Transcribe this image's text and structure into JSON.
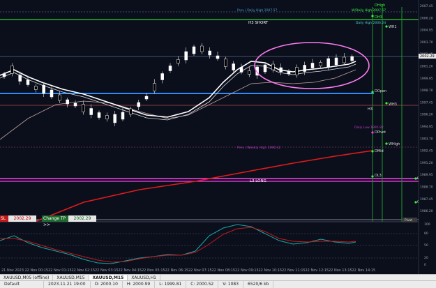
{
  "colors": {
    "background": "#0b0f1c",
    "bull_candle": "#ffffff",
    "bear_candle": "#000000",
    "ema_fast": "#ffffff",
    "ema_slow": "#c0a0a0",
    "red_trend": "#e11b1b",
    "blue_level": "#2a8cff",
    "magenta_level": "#ff3cf0",
    "green_level": "#33ff33",
    "annotation_pink": "#ff7cf0",
    "osc_teal": "#1aa6a6",
    "osc_red": "#c21a1a"
  },
  "level_labels": {
    "dhigh": "DHigh",
    "prev_daily_high": "Prev / Daily High 2007.57",
    "wdaily_high": "W/Daily High 2007.57",
    "dh3": "DH3",
    "daily_high": "Daily High 2006.24",
    "h3_short": "H3 SHORT",
    "wr1": "WR1",
    "dopen": "DOpen",
    "h3": "H3",
    "wh3": "WH3",
    "daily_low": "Daily Low 1995.82",
    "dpivot": "DPivot",
    "whigh": "WHigh",
    "prev_weekly_high": "Prev / Weekly High 1990.42",
    "dmid": "DMid",
    "dl3": "DL3",
    "l3_long": "L3 LONG",
    "qh": "QH",
    "qh2": "QH",
    "pivot_tag": "Pivot"
  },
  "price_axis": [
    "2007.45",
    "2006.20",
    "2004.95",
    "2003.70",
    "2002.45",
    "2001.20",
    "1999.95",
    "1998.70",
    "1997.45",
    "1996.20",
    "1994.95",
    "1993.70",
    "1992.45",
    "1991.20",
    "1989.95",
    "1988.70",
    "1987.45",
    "1986.20"
  ],
  "price_axis_current": "2002.29",
  "osc_axis": [
    "100",
    "80",
    "50",
    "20",
    "0"
  ],
  "orders": {
    "sl_label": "SL",
    "sl_price": "2002.29",
    "tp_label": "Change TP >>",
    "tp_price": "2002.29"
  },
  "time_axis": [
    "21 Nov 2023",
    "22 Nov 00:15",
    "22 Nov 01:15",
    "22 Nov 02:15",
    "22 Nov 03:15",
    "22 Nov 04:15",
    "22 Nov 05:15",
    "22 Nov 06:15",
    "22 Nov 07:15",
    "22 Nov 08:15",
    "22 Nov 09:15",
    "22 Nov 10:15",
    "22 Nov 11:15",
    "22 Nov 12:15",
    "22 Nov 13:15",
    "22 Nov 14:15"
  ],
  "tabs": [
    "XAUUSD,M05 (offline)",
    "XAUUSD,M15",
    "XAUUSD,M15",
    "XAUUSD,H1"
  ],
  "active_tab": 2,
  "status_bar": {
    "profile": "Default",
    "datetime": "2023.11.21 19:00",
    "open": "O: 2000.10",
    "high": "H: 2000.99",
    "low": "L: 1999.81",
    "close": "C: 2000.52",
    "volume": "V: 1083",
    "traffic": "6520/6 kb"
  }
}
